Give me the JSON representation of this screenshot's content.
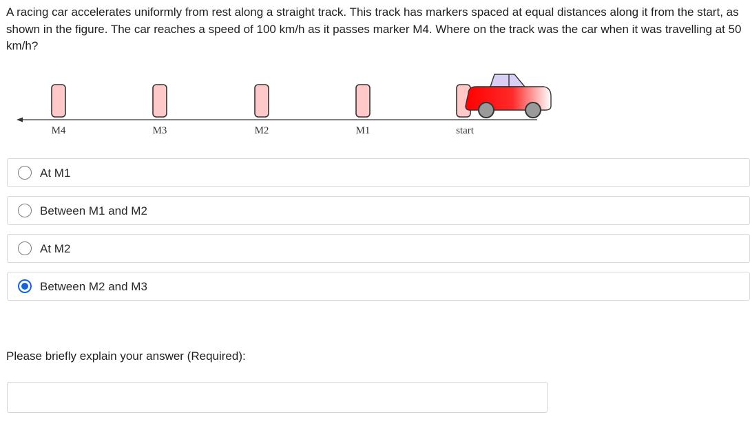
{
  "question": {
    "text": "A racing car accelerates uniformly from rest along a straight track. This track has markers spaced at equal distances along it from the start, as shown in the figure. The car reaches a speed of 100 km/h as it passes marker M4. Where on the track was the car when it was travelling at 50 km/h?"
  },
  "figure": {
    "markers": [
      {
        "label": "M4"
      },
      {
        "label": "M3"
      },
      {
        "label": "M2"
      },
      {
        "label": "M1"
      },
      {
        "label": "start"
      }
    ],
    "colors": {
      "marker_fill": "#ffc9c9",
      "marker_stroke": "#333333",
      "car_body_front": "#ff0000",
      "car_body_rear": "#ffffff",
      "car_window": "#d8d0f4",
      "wheel": "#9a9a9a"
    }
  },
  "options": [
    {
      "label": "At M1",
      "selected": false
    },
    {
      "label": "Between M1 and M2",
      "selected": false
    },
    {
      "label": "At M2",
      "selected": false
    },
    {
      "label": "Between M2 and M3",
      "selected": true
    }
  ],
  "explanation": {
    "label": "Please briefly explain your answer (Required):",
    "value": "",
    "placeholder": ""
  }
}
